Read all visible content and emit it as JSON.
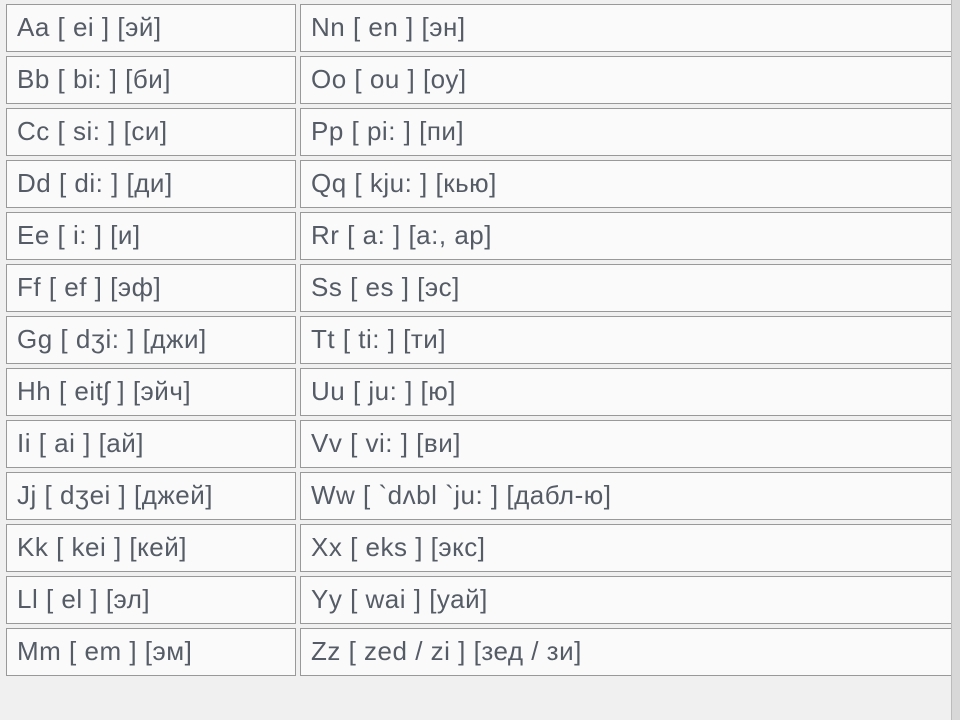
{
  "alphabet": {
    "left": [
      "Aa [ ei ] [эй]",
      "Bb [ bi: ] [би]",
      "Cc [ si: ] [си]",
      "Dd [ di: ] [ди]",
      "Ee [ i: ] [и]",
      "Ff [ ef ] [эф]",
      "Gg [ dʒi: ] [джи]",
      "Hh [ eitʃ ] [эйч]",
      "Ii [ ai ] [ай]",
      "Jj [ dʒei ] [джей]",
      "Kk [ kei ] [кей]",
      "Ll [ el ] [эл]",
      "Mm [ em ] [эм]"
    ],
    "right": [
      "Nn [ en ] [эн]",
      "Oo [ ou ] [оу]",
      "Pp [ pi: ] [пи]",
      "Qq [ kju: ] [кью]",
      "Rr [ a: ] [а:, ар]",
      "Ss [ es ] [эс]",
      "Tt [ ti: ] [ти]",
      "Uu [ ju: ] [ю]",
      "Vv [ vi: ] [ви]",
      "Ww [ `dʌbl `ju: ] [дабл-ю]",
      "Xx [ eks ] [экс]",
      "Yy [ wai ] [уай]",
      "Zz [ zed / zi ] [зед / зи]"
    ]
  }
}
